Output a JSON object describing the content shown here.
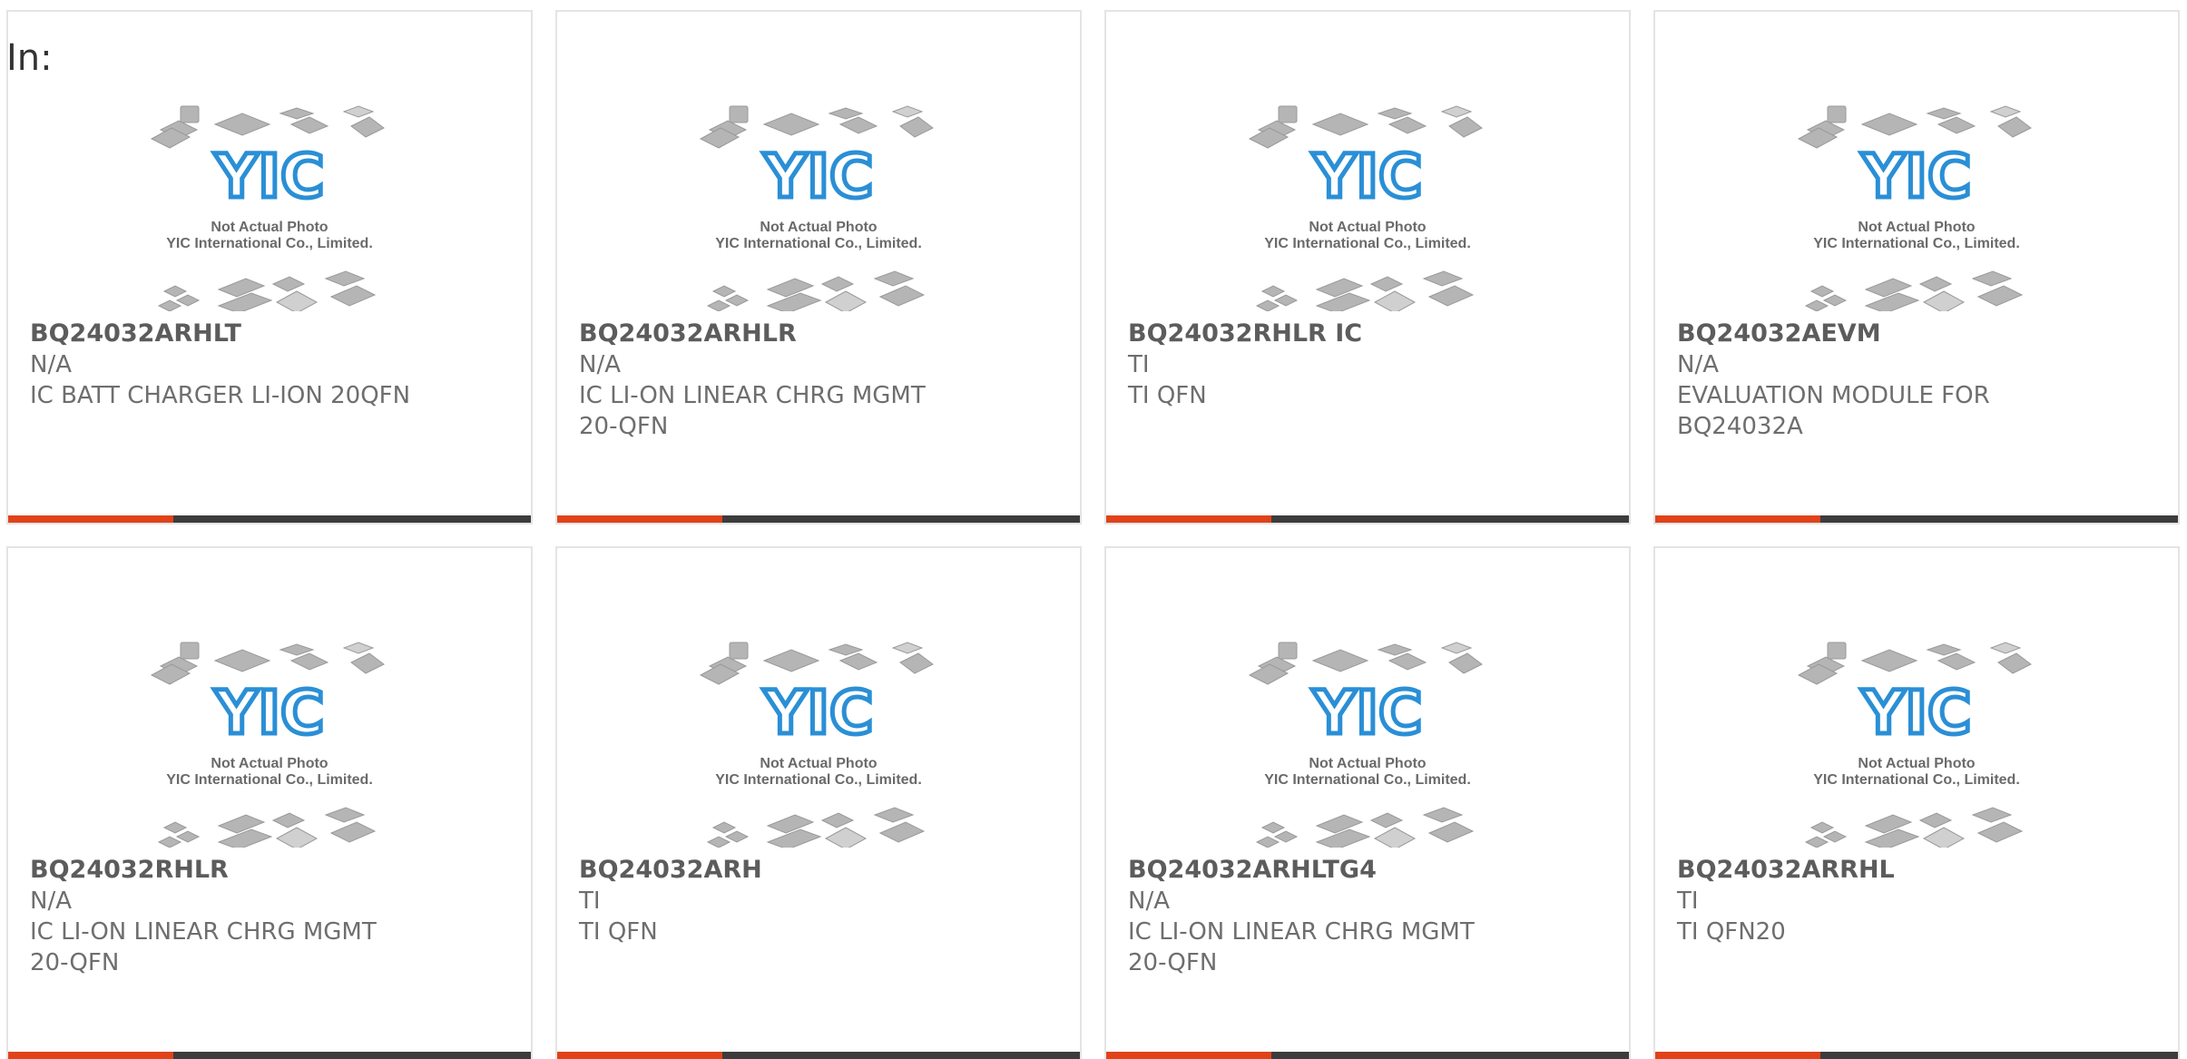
{
  "header": {
    "label": "In:"
  },
  "colors": {
    "accent_bar": "#e0421a",
    "dark_bar": "#3c3c3c",
    "logo_blue": "#2a8fd6",
    "border": "#e4e4e4"
  },
  "placeholder_image": {
    "logo_text": "YIC",
    "caption_line1": "Not Actual Photo",
    "caption_line2": "YIC International Co., Limited."
  },
  "products": [
    {
      "part": "BQ24032ARHLT",
      "maker": "N/A",
      "desc_line1": "IC BATT CHARGER LI-ION 20QFN",
      "desc_line2": ""
    },
    {
      "part": "BQ24032ARHLR",
      "maker": "N/A",
      "desc_line1": "IC LI-ON LINEAR CHRG MGMT",
      "desc_line2": "20-QFN"
    },
    {
      "part": "BQ24032RHLR IC",
      "maker": "TI",
      "desc_line1": "TI QFN",
      "desc_line2": ""
    },
    {
      "part": "BQ24032AEVM",
      "maker": "N/A",
      "desc_line1": "EVALUATION MODULE FOR",
      "desc_line2": "BQ24032A"
    },
    {
      "part": "BQ24032RHLR",
      "maker": "N/A",
      "desc_line1": "IC LI-ON LINEAR CHRG MGMT",
      "desc_line2": "20-QFN"
    },
    {
      "part": "BQ24032ARH",
      "maker": "TI",
      "desc_line1": "TI QFN",
      "desc_line2": ""
    },
    {
      "part": "BQ24032ARHLTG4",
      "maker": "N/A",
      "desc_line1": "IC LI-ON LINEAR CHRG MGMT",
      "desc_line2": "20-QFN"
    },
    {
      "part": "BQ24032ARRHL",
      "maker": "TI",
      "desc_line1": "TI QFN20",
      "desc_line2": ""
    }
  ]
}
